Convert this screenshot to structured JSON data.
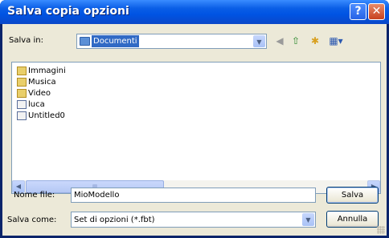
{
  "dialog": {
    "title": "Salva copia opzioni"
  },
  "save_in": {
    "label": "Salva in:",
    "value": "Documenti"
  },
  "files": [
    {
      "name": "Immagini",
      "icon": "folder-images-icon"
    },
    {
      "name": "Musica",
      "icon": "folder-music-icon"
    },
    {
      "name": "Video",
      "icon": "folder-video-icon"
    },
    {
      "name": "luca",
      "icon": "file-icon"
    },
    {
      "name": "Untitled0",
      "icon": "file-icon"
    }
  ],
  "filename": {
    "label": "Nome file:",
    "value": "MioModello"
  },
  "save_as": {
    "label": "Salva come:",
    "value": "Set di opzioni (*.fbt)"
  },
  "buttons": {
    "save": "Salva",
    "cancel": "Annulla"
  },
  "colors": {
    "titlebar": "#0054e3",
    "client": "#ece9d8",
    "selection": "#316ac5"
  }
}
